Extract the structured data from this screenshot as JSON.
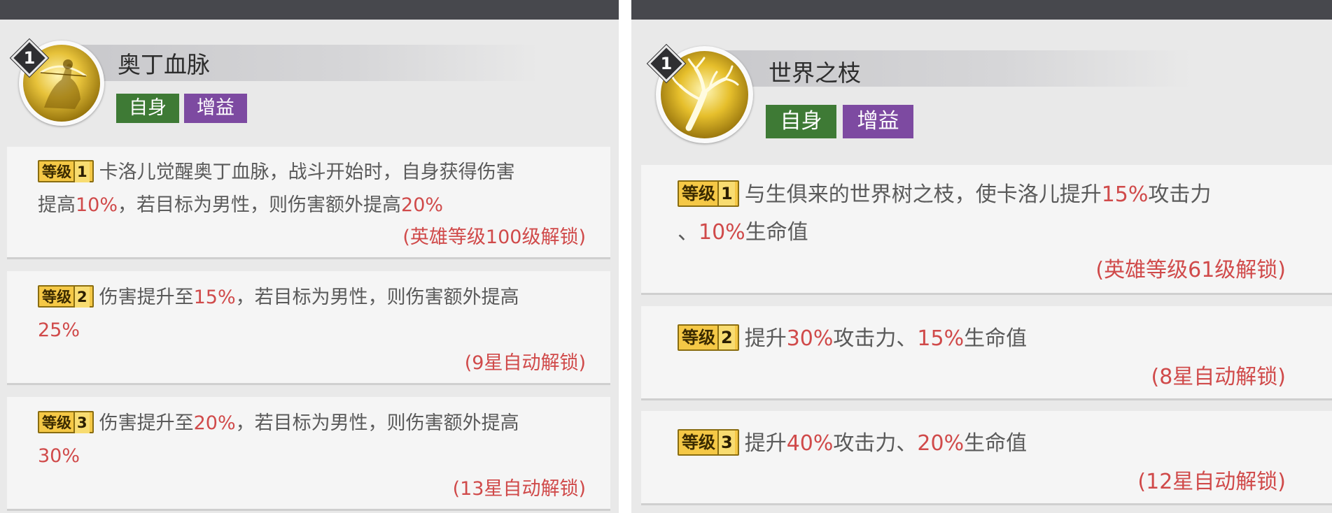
{
  "left_panel": {
    "skill_level": "1",
    "skill_name": "奥丁血脉",
    "tags": {
      "self": "自身",
      "buff": "增益"
    },
    "cards": [
      {
        "chip_label": "等级",
        "chip_num": "1",
        "line1": {
          "text": "卡洛儿觉醒奥丁血脉，战斗开始时，自身获得伤害"
        },
        "line2": {
          "pre": "提高",
          "hl1": "10%",
          "mid": "，若目标为男性，则伤害额外提高",
          "hl2": "20%"
        },
        "unlock": "(英雄等级100级解锁)"
      },
      {
        "chip_label": "等级",
        "chip_num": "2",
        "line1": {
          "pre": "伤害提升至",
          "hl1": "15%",
          "post": "，若目标为男性，则伤害额外提高"
        },
        "line2": {
          "hl": "25%"
        },
        "unlock": "(9星自动解锁)"
      },
      {
        "chip_label": "等级",
        "chip_num": "3",
        "line1": {
          "pre": "伤害提升至",
          "hl1": "20%",
          "post": "，若目标为男性，则伤害额外提高"
        },
        "line2": {
          "hl": "30%"
        },
        "unlock": "(13星自动解锁)"
      }
    ]
  },
  "right_panel": {
    "skill_level": "1",
    "skill_name": "世界之枝",
    "tags": {
      "self": "自身",
      "buff": "增益"
    },
    "cards": [
      {
        "chip_label": "等级",
        "chip_num": "1",
        "line1": {
          "pre": "与生俱来的世界树之枝，使卡洛儿提升",
          "hl1": "15%",
          "post": "攻击力"
        },
        "line2": {
          "pre": "、",
          "hl": "10%",
          "post": "生命值"
        },
        "unlock": "(英雄等级61级解锁)"
      },
      {
        "chip_label": "等级",
        "chip_num": "2",
        "line1": {
          "pre": "提升",
          "hl1": "30%",
          "mid": "攻击力、",
          "hl2": "15%",
          "post": "生命值"
        },
        "unlock": "(8星自动解锁)"
      },
      {
        "chip_label": "等级",
        "chip_num": "3",
        "line1": {
          "pre": "提升",
          "hl1": "40%",
          "mid": "攻击力、",
          "hl2": "20%",
          "post": "生命值"
        },
        "unlock": "(12星自动解锁)"
      }
    ]
  },
  "icons": {
    "left_skill_icon": "archer-silhouette-icon",
    "right_skill_icon": "tree-branch-icon"
  },
  "colors": {
    "highlight": "#d04a4a",
    "tag_self": "#3e7a35",
    "tag_buff": "#7d4aa1",
    "chip_gold": "#f5c846",
    "topbar": "#47484d"
  }
}
